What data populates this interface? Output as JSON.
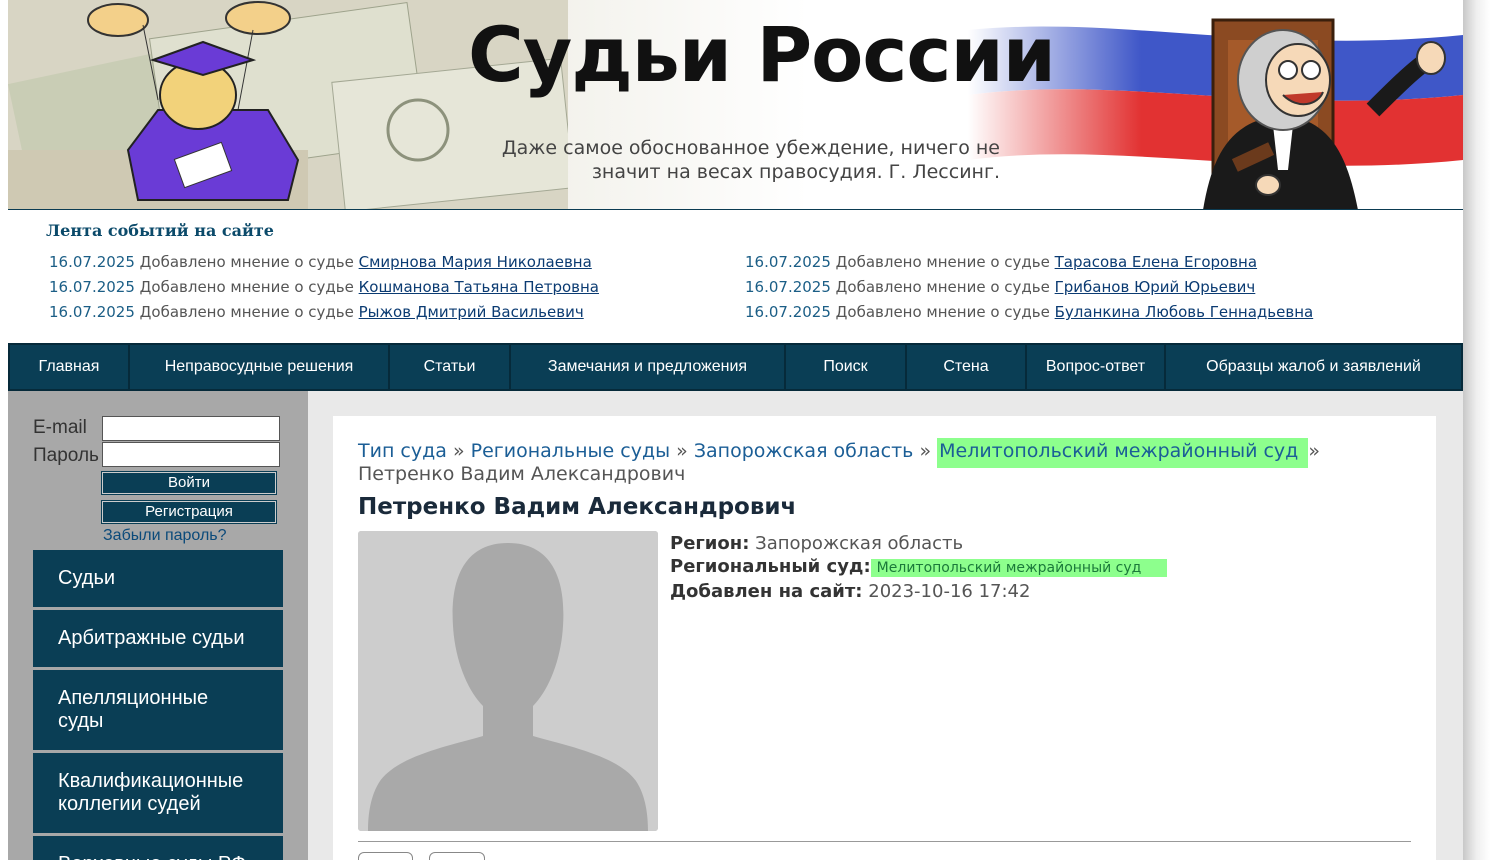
{
  "header": {
    "site_title": "Судьи России",
    "quote_line1": "Даже самое обоснованное убеждение, ничего не",
    "quote_line2": "значит на весах правосудия. Г. Лессинг."
  },
  "events": {
    "title": "Лента событий на сайте",
    "left": [
      {
        "date": "16.07.2025",
        "text": "Добавлено мнение о судье",
        "link": "Смирнова Мария Николаевна"
      },
      {
        "date": "16.07.2025",
        "text": "Добавлено мнение о судье",
        "link": "Кошманова Татьяна Петровна"
      },
      {
        "date": "16.07.2025",
        "text": "Добавлено мнение о судье",
        "link": "Рыжов Дмитрий Васильевич"
      }
    ],
    "right": [
      {
        "date": "16.07.2025",
        "text": "Добавлено мнение о судье",
        "link": "Тарасова Елена Егоровна"
      },
      {
        "date": "16.07.2025",
        "text": "Добавлено мнение о судье",
        "link": "Грибанов Юрий Юрьевич"
      },
      {
        "date": "16.07.2025",
        "text": "Добавлено мнение о судье",
        "link": "Буланкина Любовь Геннадьевна"
      }
    ]
  },
  "nav": {
    "items": [
      "Главная",
      "Неправосудные решения",
      "Статьи",
      "Замечания и предложения",
      "Поиск",
      "Стена",
      "Вопрос-ответ",
      "Образцы жалоб и заявлений"
    ]
  },
  "sidebar": {
    "email_label": "E-mail",
    "password_label": "Пароль",
    "email_value": "",
    "password_value": "",
    "login_button": "Войти",
    "register_button": "Регистрация",
    "forgot_link": "Забыли пароль?",
    "menu": [
      "Судьи",
      "Арбитражные судьи",
      "Апелляционные суды",
      "Квалификационные коллегии судей",
      "Верховные суды РФ"
    ]
  },
  "content": {
    "breadcrumb": {
      "court_type": "Тип суда",
      "regional": "Региональные суды",
      "region": "Запорожская область",
      "court": "Мелитопольский межрайонный суд",
      "current": "Петренко Вадим Александрович",
      "separator": "»"
    },
    "judge_name": "Петренко Вадим Александрович",
    "region_label": "Регион:",
    "region_value": "Запорожская область",
    "court_label": "Региональный суд:",
    "court_value": "Мелитопольский межрайонный суд",
    "added_label": "Добавлен на сайт:",
    "added_value": "2023-10-16 17:42"
  },
  "colors": {
    "nav_bg": "#0a3e55",
    "highlight": "#8dff8d",
    "link": "#1b5e96"
  }
}
